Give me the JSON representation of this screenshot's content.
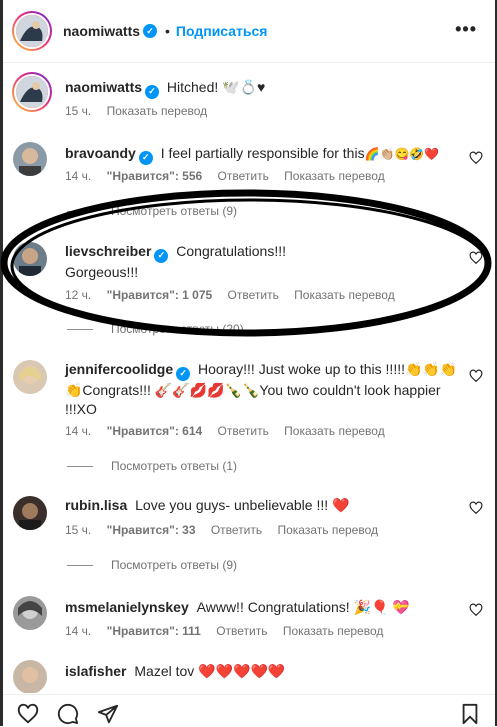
{
  "header": {
    "username": "naomiwatts",
    "follow_label": "Подписаться",
    "dot": "•"
  },
  "caption": {
    "username": "naomiwatts",
    "text": "Hitched! 🕊️💍♥",
    "time": "15 ч.",
    "translate": "Показать перевод"
  },
  "comments": [
    {
      "username": "bravoandy",
      "text": "I feel partially responsible for this",
      "emojis": "🌈👏🏼😋🤣❤️",
      "time": "14 ч.",
      "likes": "\"Нравится\": 556",
      "reply": "Ответить",
      "translate": "Показать перевод",
      "view_replies": "Посмотреть ответы (9)"
    },
    {
      "username": "lievschreiber",
      "text_line1": "Congratulations!!!",
      "text_line2": "Gorgeous!!!",
      "time": "12 ч.",
      "likes": "\"Нравится\": 1 075",
      "reply": "Ответить",
      "translate": "Показать перевод",
      "view_replies": "Посмотреть ответы (20)"
    },
    {
      "username": "jennifercoolidge",
      "text_line1": "Hooray!!! Just woke up to this !!!!!👏👏👏",
      "text_line2": "👏Congrats!!! 🎸🎸💋💋🍾🍾You two couldn't look happier",
      "text_line3": "!!!XO",
      "time": "14 ч.",
      "likes": "\"Нравится\": 614",
      "reply": "Ответить",
      "translate": "Показать перевод",
      "view_replies": "Посмотреть ответы (1)"
    },
    {
      "username": "rubin.lisa",
      "text": "Love you guys- unbelievable !!! ❤️",
      "time": "15 ч.",
      "likes": "\"Нравится\": 33",
      "reply": "Ответить",
      "translate": "Показать перевод",
      "view_replies": "Посмотреть ответы (9)"
    },
    {
      "username": "msmelanielynskey",
      "text": "Awww!! Congratulations! 🎉🎈 💝",
      "time": "14 ч.",
      "likes": "\"Нравится\": 111",
      "reply": "Ответить",
      "translate": "Показать перевод"
    },
    {
      "username": "islafisher",
      "text": "Mazel tov ❤️❤️❤️❤️❤️"
    }
  ],
  "colors": {
    "accent": "#0095f6",
    "heart_red": "#ed1c24",
    "annotation": "#000000"
  },
  "icons": {
    "like": "heart-icon",
    "comment": "comment-icon",
    "share": "paper-plane-icon",
    "save": "bookmark-icon",
    "more": "more-options-icon"
  }
}
